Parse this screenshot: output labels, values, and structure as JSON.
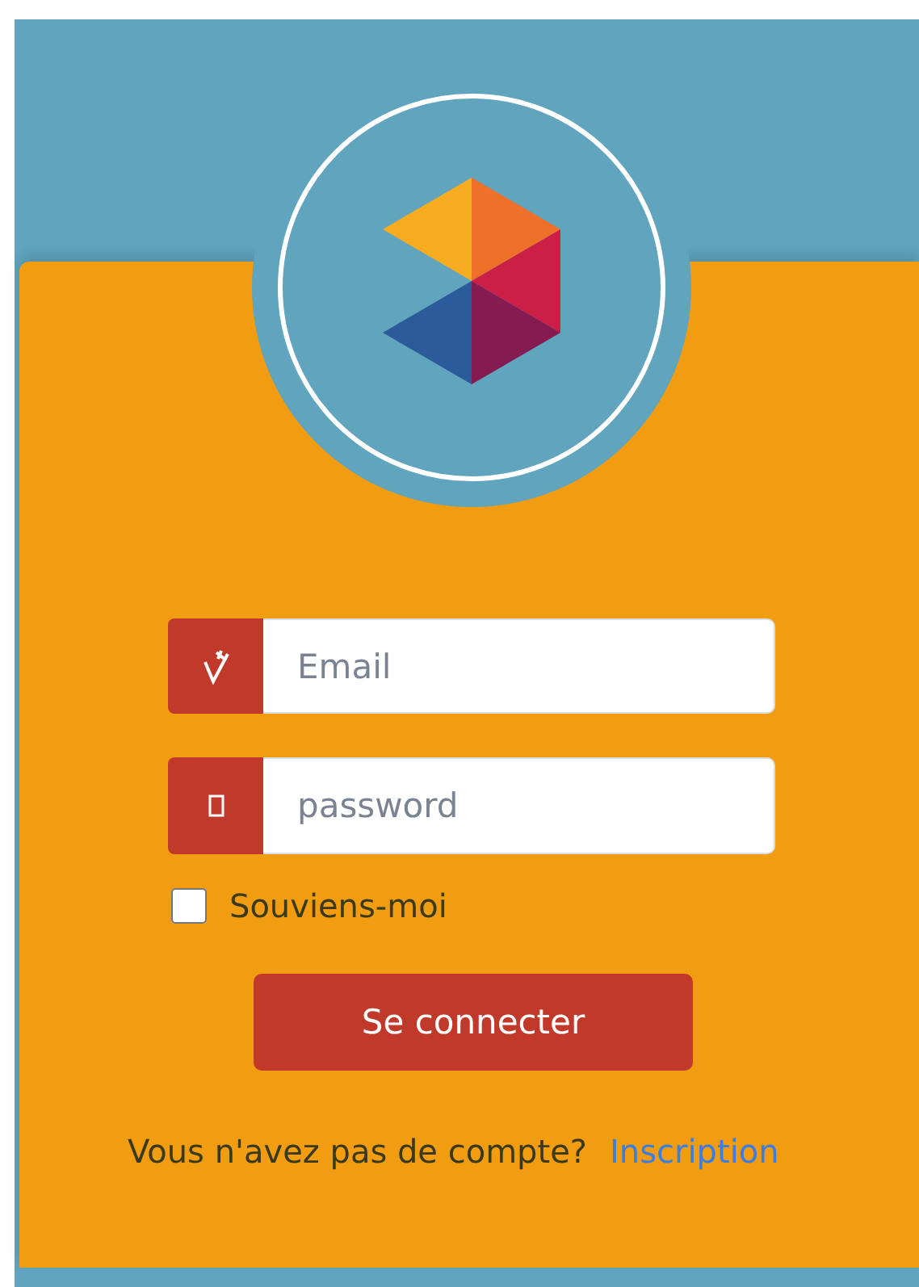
{
  "fields": [
    {
      "kind": "email",
      "placeholder": "Email"
    },
    {
      "kind": "password",
      "placeholder": "password"
    }
  ],
  "remember": {
    "label": "Souviens-moi",
    "checked": false
  },
  "submit": {
    "label": "Se connecter"
  },
  "footer": {
    "text": "Vous n'avez pas de compte?",
    "link": "Inscription"
  }
}
